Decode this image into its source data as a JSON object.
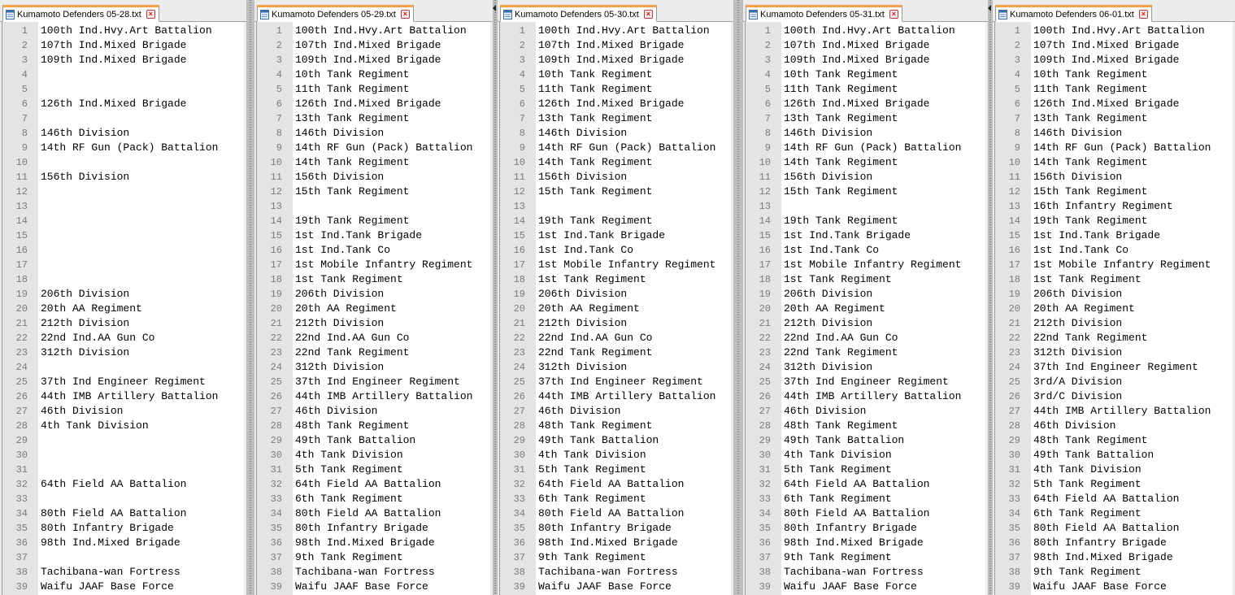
{
  "window": {
    "panes": [
      {
        "tab_label": "Kumamoto Defenders 05-28.txt",
        "lines": [
          "100th Ind.Hvy.Art Battalion",
          "107th Ind.Mixed Brigade",
          "109th Ind.Mixed Brigade",
          "",
          "",
          "126th Ind.Mixed Brigade",
          "",
          "146th Division",
          "14th RF Gun (Pack) Battalion",
          "",
          "156th Division",
          "",
          "",
          "",
          "",
          "",
          "",
          "",
          "206th Division",
          "20th AA Regiment",
          "212th Division",
          "22nd Ind.AA Gun Co",
          "312th Division",
          "",
          "37th Ind Engineer Regiment",
          "44th IMB Artillery Battalion",
          "46th Division",
          "4th Tank Division",
          "",
          "",
          "",
          "64th Field AA Battalion",
          "",
          "80th Field AA Battalion",
          "80th Infantry Brigade",
          "98th Ind.Mixed Brigade",
          "",
          "Tachibana-wan Fortress",
          "Waifu JAAF Base Force"
        ]
      },
      {
        "tab_label": "Kumamoto Defenders 05-29.txt",
        "lines": [
          "100th Ind.Hvy.Art Battalion",
          "107th Ind.Mixed Brigade",
          "109th Ind.Mixed Brigade",
          "10th Tank Regiment",
          "11th Tank Regiment",
          "126th Ind.Mixed Brigade",
          "13th Tank Regiment",
          "146th Division",
          "14th RF Gun (Pack) Battalion",
          "14th Tank Regiment",
          "156th Division",
          "15th Tank Regiment",
          "",
          "19th Tank Regiment",
          "1st Ind.Tank Brigade",
          "1st Ind.Tank Co",
          "1st Mobile Infantry Regiment",
          "1st Tank Regiment",
          "206th Division",
          "20th AA Regiment",
          "212th Division",
          "22nd Ind.AA Gun Co",
          "22nd Tank Regiment",
          "312th Division",
          "37th Ind Engineer Regiment",
          "44th IMB Artillery Battalion",
          "46th Division",
          "48th Tank Regiment",
          "49th Tank Battalion",
          "4th Tank Division",
          "5th Tank Regiment",
          "64th Field AA Battalion",
          "6th Tank Regiment",
          "80th Field AA Battalion",
          "80th Infantry Brigade",
          "98th Ind.Mixed Brigade",
          "9th Tank Regiment",
          "Tachibana-wan Fortress",
          "Waifu JAAF Base Force"
        ]
      },
      {
        "tab_label": "Kumamoto Defenders 05-30.txt",
        "lines": [
          "100th Ind.Hvy.Art Battalion",
          "107th Ind.Mixed Brigade",
          "109th Ind.Mixed Brigade",
          "10th Tank Regiment",
          "11th Tank Regiment",
          "126th Ind.Mixed Brigade",
          "13th Tank Regiment",
          "146th Division",
          "14th RF Gun (Pack) Battalion",
          "14th Tank Regiment",
          "156th Division",
          "15th Tank Regiment",
          "",
          "19th Tank Regiment",
          "1st Ind.Tank Brigade",
          "1st Ind.Tank Co",
          "1st Mobile Infantry Regiment",
          "1st Tank Regiment",
          "206th Division",
          "20th AA Regiment",
          "212th Division",
          "22nd Ind.AA Gun Co",
          "22nd Tank Regiment",
          "312th Division",
          "37th Ind Engineer Regiment",
          "44th IMB Artillery Battalion",
          "46th Division",
          "48th Tank Regiment",
          "49th Tank Battalion",
          "4th Tank Division",
          "5th Tank Regiment",
          "64th Field AA Battalion",
          "6th Tank Regiment",
          "80th Field AA Battalion",
          "80th Infantry Brigade",
          "98th Ind.Mixed Brigade",
          "9th Tank Regiment",
          "Tachibana-wan Fortress",
          "Waifu JAAF Base Force"
        ]
      },
      {
        "tab_label": "Kumamoto Defenders 05-31.txt",
        "lines": [
          "100th Ind.Hvy.Art Battalion",
          "107th Ind.Mixed Brigade",
          "109th Ind.Mixed Brigade",
          "10th Tank Regiment",
          "11th Tank Regiment",
          "126th Ind.Mixed Brigade",
          "13th Tank Regiment",
          "146th Division",
          "14th RF Gun (Pack) Battalion",
          "14th Tank Regiment",
          "156th Division",
          "15th Tank Regiment",
          "",
          "19th Tank Regiment",
          "1st Ind.Tank Brigade",
          "1st Ind.Tank Co",
          "1st Mobile Infantry Regiment",
          "1st Tank Regiment",
          "206th Division",
          "20th AA Regiment",
          "212th Division",
          "22nd Ind.AA Gun Co",
          "22nd Tank Regiment",
          "312th Division",
          "37th Ind Engineer Regiment",
          "44th IMB Artillery Battalion",
          "46th Division",
          "48th Tank Regiment",
          "49th Tank Battalion",
          "4th Tank Division",
          "5th Tank Regiment",
          "64th Field AA Battalion",
          "6th Tank Regiment",
          "80th Field AA Battalion",
          "80th Infantry Brigade",
          "98th Ind.Mixed Brigade",
          "9th Tank Regiment",
          "Tachibana-wan Fortress",
          "Waifu JAAF Base Force"
        ]
      },
      {
        "tab_label": "Kumamoto Defenders 06-01.txt",
        "lines": [
          "100th Ind.Hvy.Art Battalion",
          "107th Ind.Mixed Brigade",
          "109th Ind.Mixed Brigade",
          "10th Tank Regiment",
          "11th Tank Regiment",
          "126th Ind.Mixed Brigade",
          "13th Tank Regiment",
          "146th Division",
          "14th RF Gun (Pack) Battalion",
          "14th Tank Regiment",
          "156th Division",
          "15th Tank Regiment",
          "16th Infantry Regiment",
          "19th Tank Regiment",
          "1st Ind.Tank Brigade",
          "1st Ind.Tank Co",
          "1st Mobile Infantry Regiment",
          "1st Tank Regiment",
          "206th Division",
          "20th AA Regiment",
          "212th Division",
          "22nd Tank Regiment",
          "312th Division",
          "37th Ind Engineer Regiment",
          "3rd/A Division",
          "3rd/C Division",
          "44th IMB Artillery Battalion",
          "46th Division",
          "48th Tank Regiment",
          "49th Tank Battalion",
          "4th Tank Division",
          "5th Tank Regiment",
          "64th Field AA Battalion",
          "6th Tank Regiment",
          "80th Field AA Battalion",
          "80th Infantry Brigade",
          "98th Ind.Mixed Brigade",
          "9th Tank Regiment",
          "Waifu JAAF Base Force"
        ]
      }
    ],
    "icons": {
      "file": "file-icon",
      "close": "close-icon"
    },
    "colors": {
      "tab_accent": "#f5a04a",
      "gutter_bg": "#e4e4e4",
      "close_red": "#c02020"
    }
  }
}
